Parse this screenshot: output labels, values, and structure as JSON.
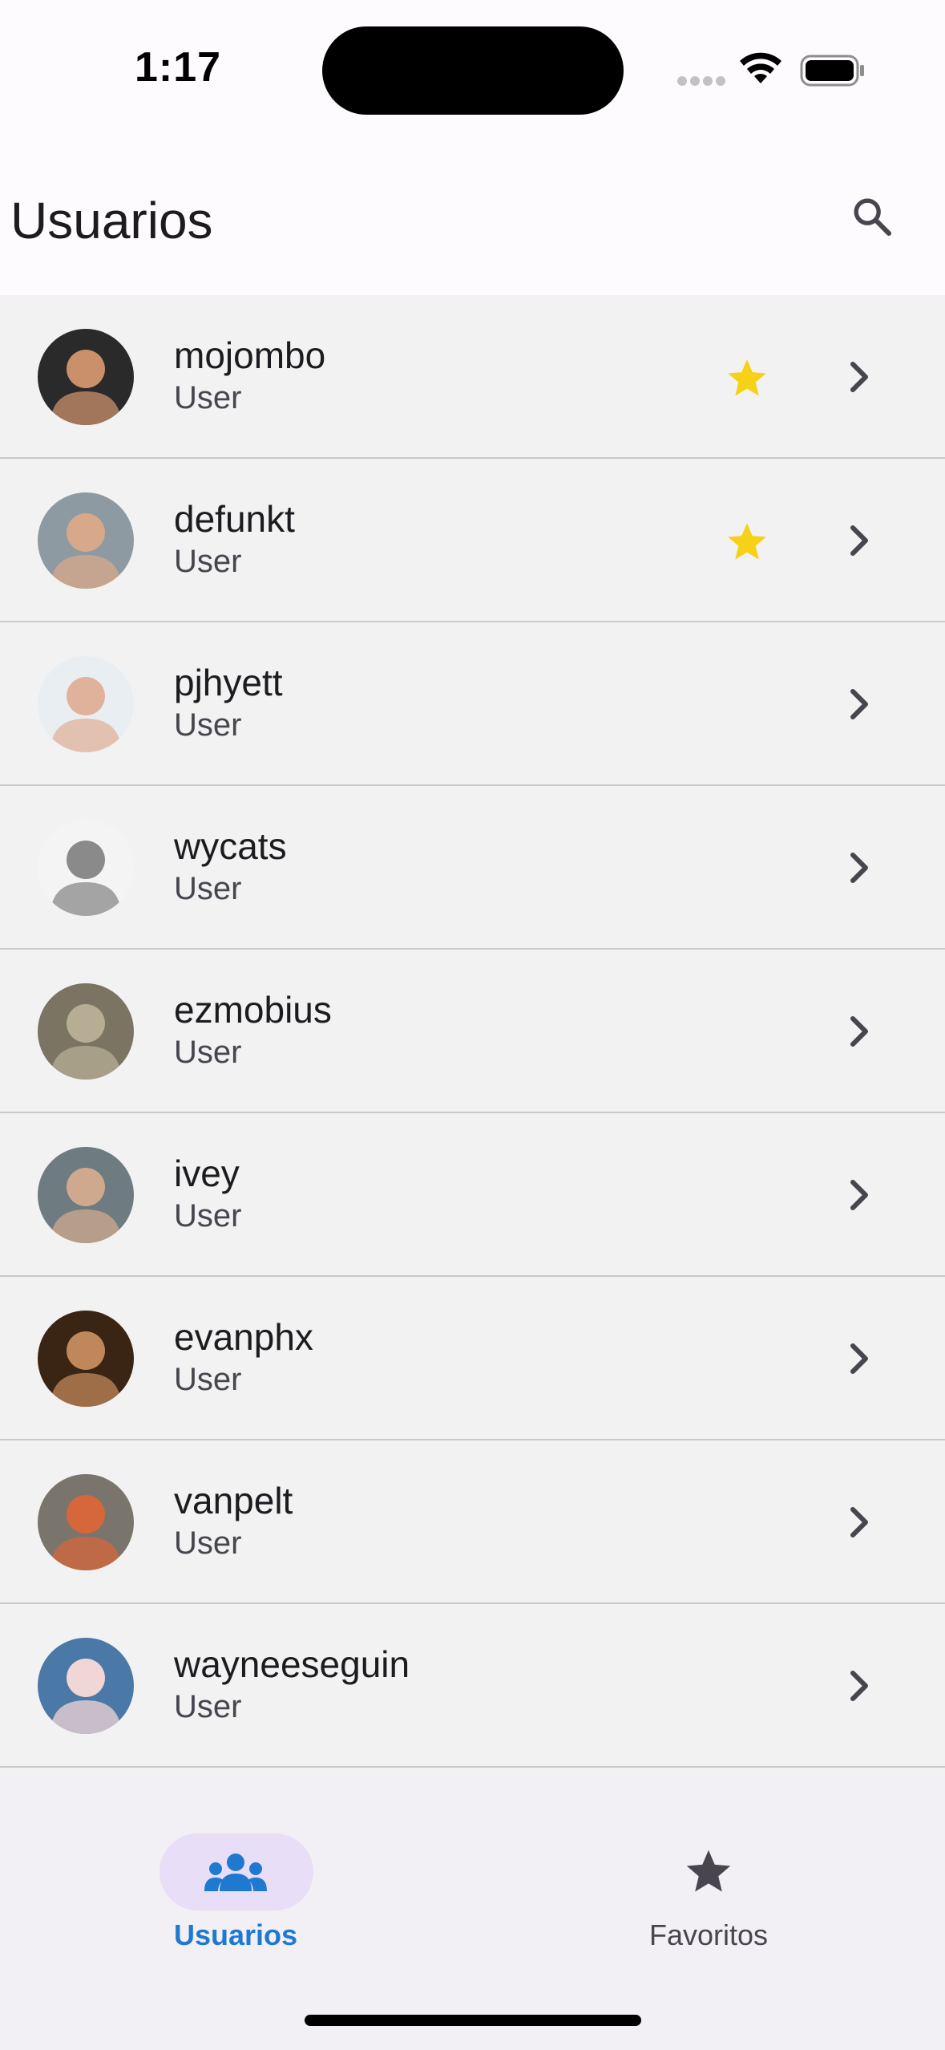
{
  "status_bar": {
    "time": "1:17"
  },
  "app_bar": {
    "title": "Usuarios",
    "search_icon": "search-icon"
  },
  "users": [
    {
      "login": "mojombo",
      "type": "User",
      "favorite": true,
      "avatar_bg": "#2a2a2a",
      "avatar_fg": "#c9906b"
    },
    {
      "login": "defunkt",
      "type": "User",
      "favorite": true,
      "avatar_bg": "#8e9aa1",
      "avatar_fg": "#d7a88a"
    },
    {
      "login": "pjhyett",
      "type": "User",
      "favorite": false,
      "avatar_bg": "#e9eef2",
      "avatar_fg": "#e0b19b"
    },
    {
      "login": "wycats",
      "type": "User",
      "favorite": false,
      "avatar_bg": "#f4f4f4",
      "avatar_fg": "#8a8a8a"
    },
    {
      "login": "ezmobius",
      "type": "User",
      "favorite": false,
      "avatar_bg": "#7b7463",
      "avatar_fg": "#b7ad94"
    },
    {
      "login": "ivey",
      "type": "User",
      "favorite": false,
      "avatar_bg": "#6e7b80",
      "avatar_fg": "#cfa98e"
    },
    {
      "login": "evanphx",
      "type": "User",
      "favorite": false,
      "avatar_bg": "#3a2514",
      "avatar_fg": "#c0875a"
    },
    {
      "login": "vanpelt",
      "type": "User",
      "favorite": false,
      "avatar_bg": "#7a756c",
      "avatar_fg": "#d6673a"
    },
    {
      "login": "wayneeseguin",
      "type": "User",
      "favorite": false,
      "avatar_bg": "#4a79a8",
      "avatar_fg": "#f1d6d6"
    }
  ],
  "bottom_nav": {
    "items": [
      {
        "label": "Usuarios",
        "icon": "group-icon",
        "selected": true
      },
      {
        "label": "Favoritos",
        "icon": "star-icon",
        "selected": false
      }
    ]
  },
  "colors": {
    "accent": "#1f79d1",
    "star": "#f7d117",
    "indicator": "#e8def8",
    "nav_background": "#f2eff5",
    "list_background": "#f2f2f2"
  }
}
